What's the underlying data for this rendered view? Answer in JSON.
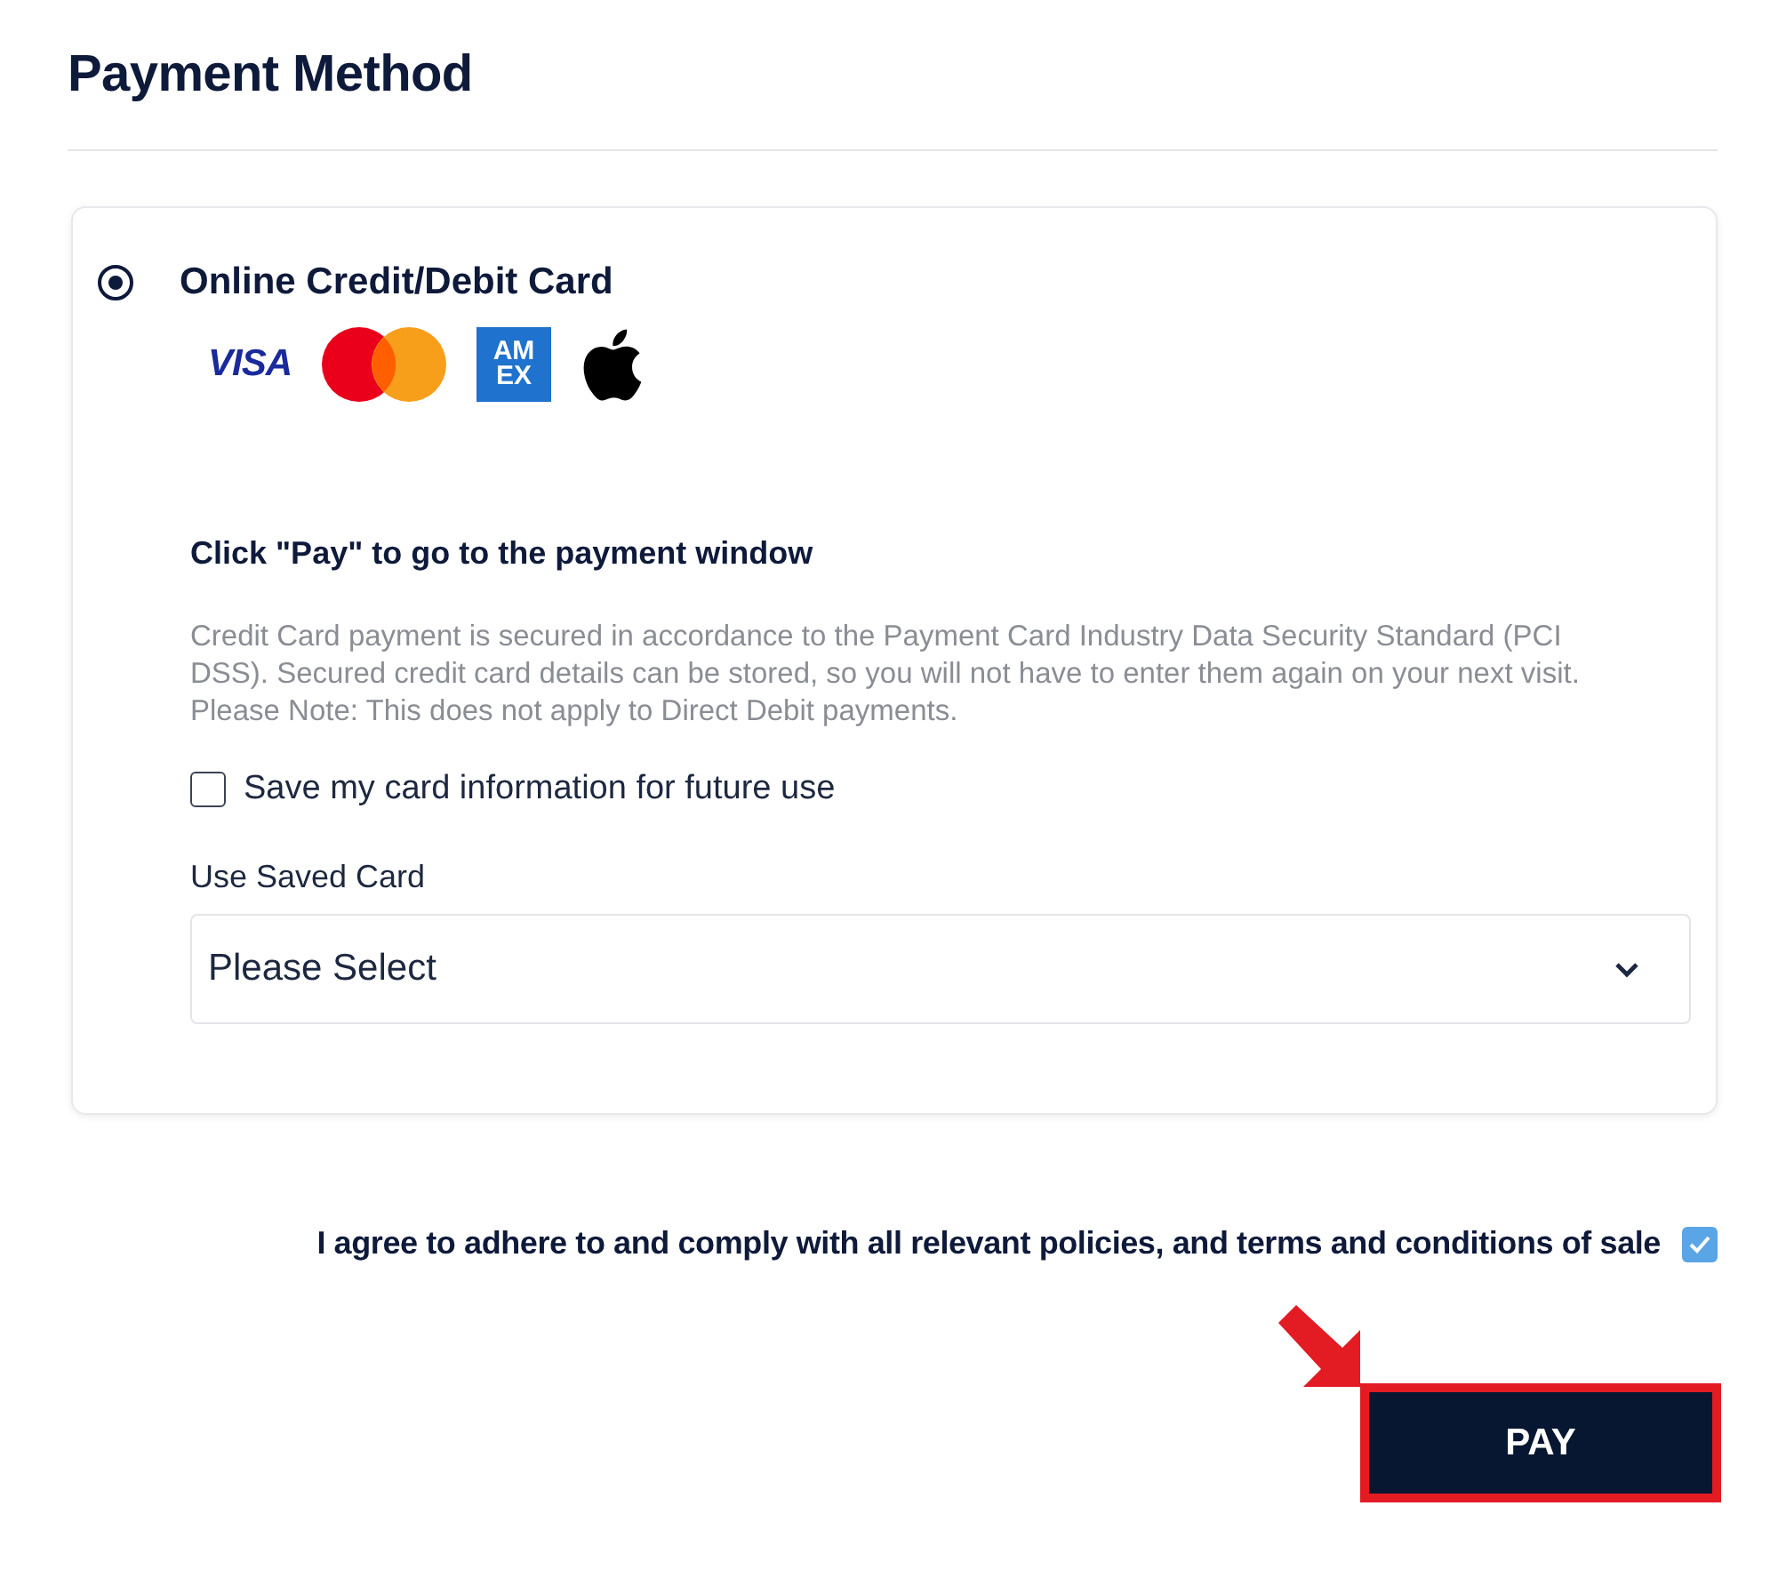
{
  "title": "Payment Method",
  "payment_option": {
    "label": "Online Credit/Debit Card",
    "selected": true,
    "card_logos": [
      {
        "kind": "visa",
        "text": "VISA"
      },
      {
        "kind": "mastercard"
      },
      {
        "kind": "amex",
        "lines": [
          "AM",
          "EX"
        ]
      },
      {
        "kind": "apple"
      }
    ]
  },
  "instruction": "Click \"Pay\" to go to the payment window",
  "notice": "Credit Card payment is secured in accordance to the Payment Card Industry Data Security Standard (PCI DSS). Secured credit card details can be stored, so you will not have to enter them again on your next visit. Please Note: This does not apply to Direct Debit payments.",
  "save_card": {
    "label": "Save my card information for future use",
    "checked": false
  },
  "saved_card": {
    "label": "Use Saved Card",
    "value": "Please Select"
  },
  "agreement": {
    "label": "I agree to adhere to and comply with all relevant policies, and terms and conditions of sale",
    "checked": true
  },
  "pay_button": {
    "label": "PAY",
    "highlighted": true
  }
}
